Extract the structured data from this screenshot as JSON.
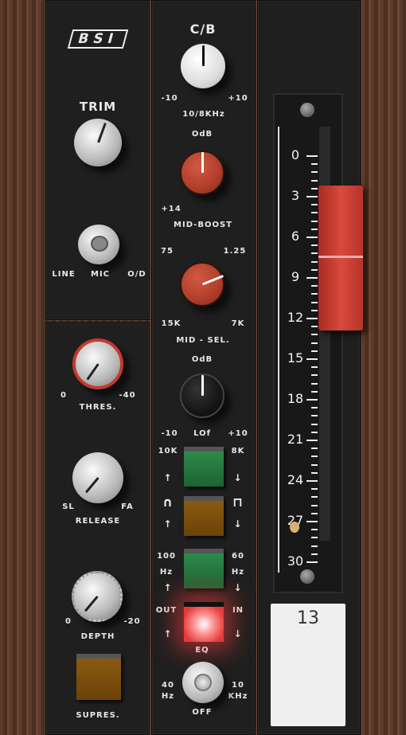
{
  "brand": "BSI",
  "preamp": {
    "trim": "TRIM",
    "switch_labels": [
      "LINE",
      "MIC",
      "O/D"
    ]
  },
  "dynamics": {
    "threshold": {
      "label": "THRES.",
      "min": "0",
      "max": "-40"
    },
    "release": {
      "label": "RELEASE",
      "min": "SL",
      "max": "FA"
    },
    "depth": {
      "label": "DEPTH",
      "min": "0",
      "max": "-20"
    },
    "supres": {
      "label": "SUPRES."
    }
  },
  "eq": {
    "cb": {
      "title": "C/B",
      "min": "-10",
      "max": "+10",
      "label": "10/8KHz"
    },
    "mid_boost": {
      "top": "OdB",
      "min": "+14",
      "label": "MID-BOOST"
    },
    "mid_sel": {
      "tl": "75",
      "tr": "1.25",
      "bl": "15K",
      "br": "7K",
      "label": "MID - SEL."
    },
    "lo": {
      "top": "OdB",
      "min": "-10",
      "label": "LOf",
      "max": "+10"
    },
    "hf_switch": {
      "left": "10K",
      "right": "8K",
      "up": "↑",
      "down": "↓"
    },
    "shape_switch": {
      "left": "∩",
      "right": "⊓",
      "up": "↑",
      "down": "↓"
    },
    "lf_switch": {
      "left": "100",
      "left_unit": "Hz",
      "right": "60",
      "right_unit": "Hz",
      "up": "↑",
      "down": "↓"
    },
    "eq_switch": {
      "left": "OUT",
      "right": "IN",
      "label": "EQ",
      "up": "↑",
      "down": "↓",
      "state": "IN"
    },
    "filter": {
      "left": "40",
      "left_unit": "Hz",
      "right": "10",
      "right_unit": "KHz",
      "label": "OFF"
    }
  },
  "fader": {
    "scale": [
      "0",
      "3",
      "6",
      "9",
      "12",
      "15",
      "18",
      "21",
      "24",
      "27",
      "30"
    ],
    "channel": "13"
  },
  "colors": {
    "accent_red": "#b03d2a",
    "green": "#1f6b37",
    "amber": "#7a4d0c"
  }
}
